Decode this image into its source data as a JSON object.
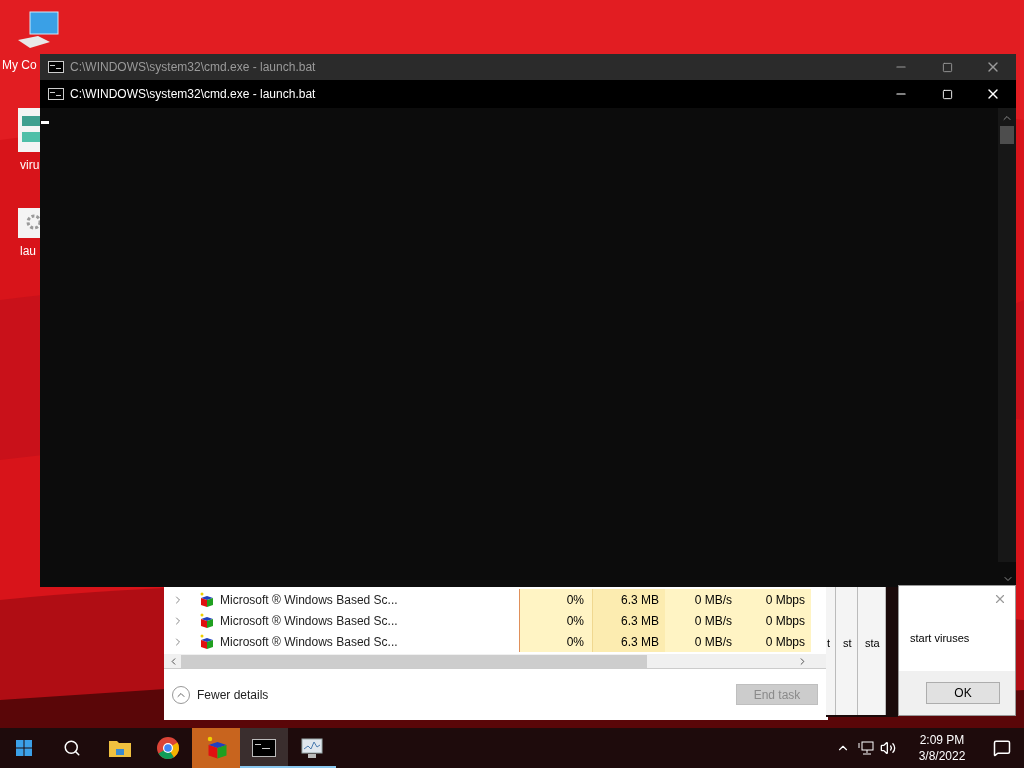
{
  "desktop": {
    "icons": [
      {
        "kind": "computer",
        "label": "My Co"
      },
      {
        "kind": "script",
        "label": "viru"
      },
      {
        "kind": "settings",
        "label": "lau"
      }
    ]
  },
  "console_back": {
    "title": "C:\\WINDOWS\\system32\\cmd.exe - launch.bat"
  },
  "console_front": {
    "title": "C:\\WINDOWS\\system32\\cmd.exe - launch.bat"
  },
  "task_manager": {
    "rows": [
      {
        "name": "Microsoft ® Windows Based Sc...",
        "cpu": "0%",
        "memory": "6.3 MB",
        "disk": "0 MB/s",
        "network": "0 Mbps"
      },
      {
        "name": "Microsoft ® Windows Based Sc...",
        "cpu": "0%",
        "memory": "6.3 MB",
        "disk": "0 MB/s",
        "network": "0 Mbps"
      },
      {
        "name": "Microsoft ® Windows Based Sc...",
        "cpu": "0%",
        "memory": "6.3 MB",
        "disk": "0 MB/s",
        "network": "0 Mbps"
      }
    ],
    "fewer_details": "Fewer details",
    "end_task": {
      "label": "End task",
      "disabled": true
    }
  },
  "stacked_dialogs": [
    {
      "text": "t"
    },
    {
      "text": "st"
    },
    {
      "text": "sta"
    }
  ],
  "dialog": {
    "message": "start viruses",
    "button": "OK"
  },
  "taskbar": {
    "apps": [
      {
        "kind": "search",
        "selected": false,
        "running": false,
        "attention": false
      },
      {
        "kind": "folder",
        "selected": false,
        "running": false,
        "attention": false
      },
      {
        "kind": "browser",
        "selected": false,
        "running": false,
        "attention": false
      },
      {
        "kind": "cube",
        "selected": false,
        "running": false,
        "attention": true
      },
      {
        "kind": "console",
        "selected": true,
        "running": true,
        "attention": false
      },
      {
        "kind": "monitor",
        "selected": false,
        "running": true,
        "attention": false
      }
    ],
    "time": "2:09 PM",
    "date": "3/8/2022"
  }
}
